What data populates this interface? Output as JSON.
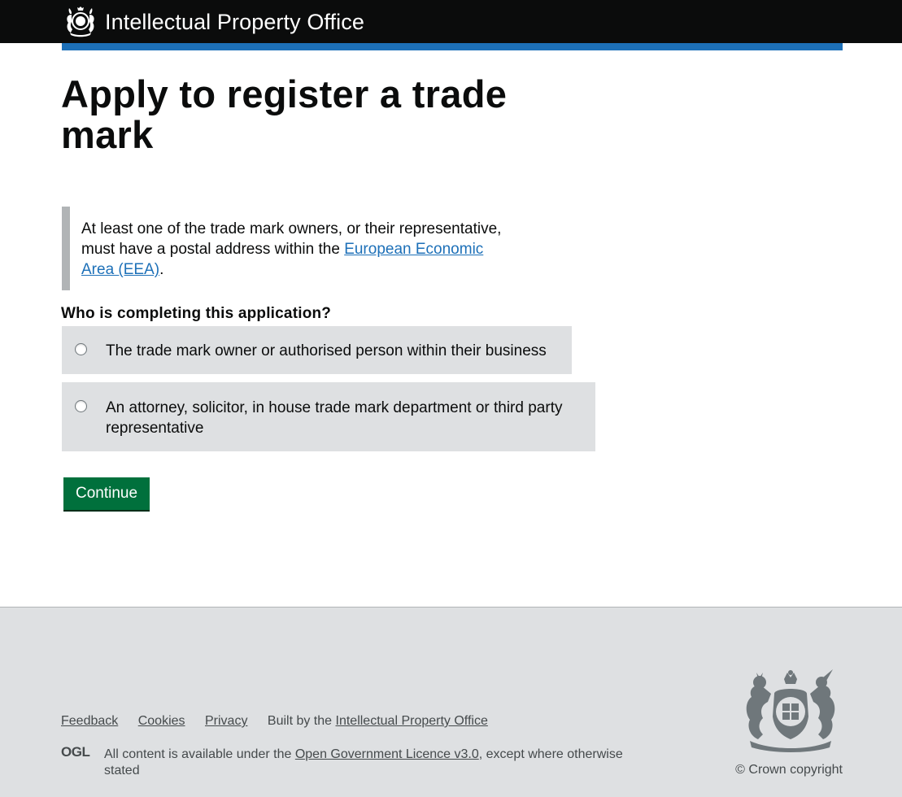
{
  "header": {
    "brand": "Intellectual Property Office",
    "logo_icon": "royal-coat-of-arms-icon"
  },
  "main": {
    "title": "Apply to register a trade mark",
    "inset": {
      "text_before": "At least one of the trade mark owners, or their representative, must have a postal address within the",
      "link": "European Economic Area (EEA)",
      "text_after": "."
    },
    "question": "Who is completing this application?",
    "options": [
      {
        "label": "The trade mark owner or authorised person within their business",
        "checked": false
      },
      {
        "label": "An attorney, solicitor, in house trade mark department or third party representative",
        "checked": false
      }
    ],
    "continue_label": "Continue"
  },
  "footer": {
    "links": [
      "Feedback",
      "Cookies",
      "Privacy"
    ],
    "built_by_prefix": "Built by the",
    "built_by_link": "Intellectual Property Office",
    "ogl_logo": "OGL",
    "licence_prefix": "All content is available under the",
    "licence_link": "Open Government Licence v3.0",
    "licence_suffix": ", except where otherwise stated",
    "copyright": "© Crown copyright",
    "crest_icon": "royal-coat-of-arms-icon"
  },
  "colors": {
    "header_bg": "#0b0c0c",
    "accent_bar": "#1d70b8",
    "link": "#1d70b8",
    "button": "#00703c",
    "option_bg": "#dee0e2",
    "footer_bg": "#dee0e2",
    "inset_border": "#b1b4b6"
  }
}
